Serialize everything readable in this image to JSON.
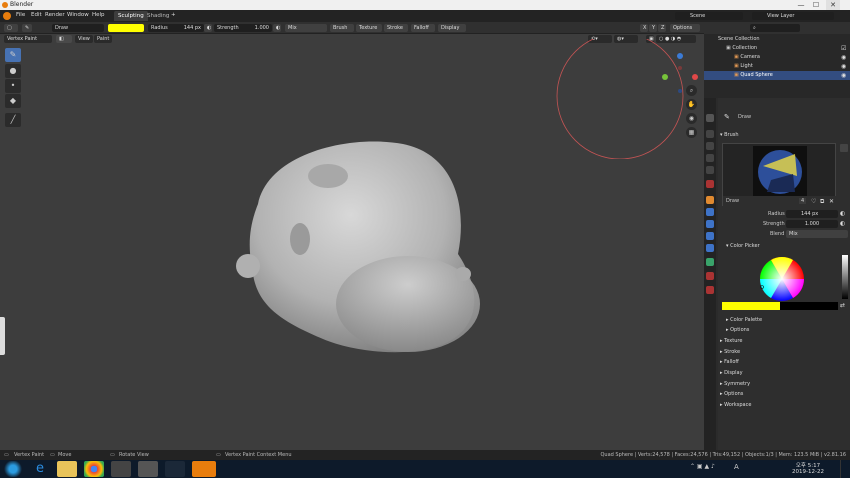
{
  "titlebar": {
    "title": "Blender",
    "minimize": "—",
    "maximize": "☐",
    "close": "✕"
  },
  "topbar": {
    "menus": [
      "File",
      "Edit",
      "Render",
      "Window",
      "Help"
    ],
    "workspaces": [
      "Sculpting",
      "Shading"
    ],
    "add_tab": "+",
    "scene_label": "Scene",
    "view_layer_label": "View Layer"
  },
  "header": {
    "brush_name": "Draw",
    "radius_label": "Radius",
    "radius_value": "144 px",
    "strength_label": "Strength",
    "strength_value": "1.000",
    "blend": "Mix",
    "menus": [
      "Brush",
      "Texture",
      "Stroke",
      "Falloff",
      "Display"
    ],
    "axes": [
      "X",
      "Y",
      "Z"
    ],
    "options": "Options",
    "color": "#ffff00"
  },
  "viewport": {
    "mode": "Vertex Paint",
    "menus": [
      "View",
      "Paint"
    ],
    "gizmo_labels": {
      "x": "X",
      "y": "Y",
      "z": "Z"
    }
  },
  "outliner": {
    "title": "Scene Collection",
    "items": [
      {
        "label": "Collection"
      },
      {
        "label": "Camera"
      },
      {
        "label": "Light"
      },
      {
        "label": "Quad Sphere"
      }
    ]
  },
  "properties": {
    "tool_name": "Draw",
    "brush_section": "Brush",
    "brush_preview_name": "Draw",
    "brush_users": "4",
    "radius_label": "Radius",
    "radius_value": "144 px",
    "strength_label": "Strength",
    "strength_value": "1.000",
    "blend_label": "Blend",
    "blend_value": "Mix",
    "color_picker": "Color Picker",
    "color_palette": "Color Palette",
    "options_sub": "Options",
    "panels": [
      "Texture",
      "Stroke",
      "Falloff",
      "Display",
      "Symmetry",
      "Options",
      "Workspace"
    ]
  },
  "statusbar": {
    "left_items": [
      "Vertex Paint",
      "Move",
      "Rotate View",
      "Vertex Paint Context Menu"
    ],
    "stats": "Quad Sphere | Verts:24,578 | Faces:24,576 | Tris:49,152 | Objects:1/3 | Mem: 123.5 MiB | v2.81.16"
  },
  "taskbar": {
    "time": "오후 5:17",
    "date": "2019-12-22",
    "lang": "A"
  }
}
